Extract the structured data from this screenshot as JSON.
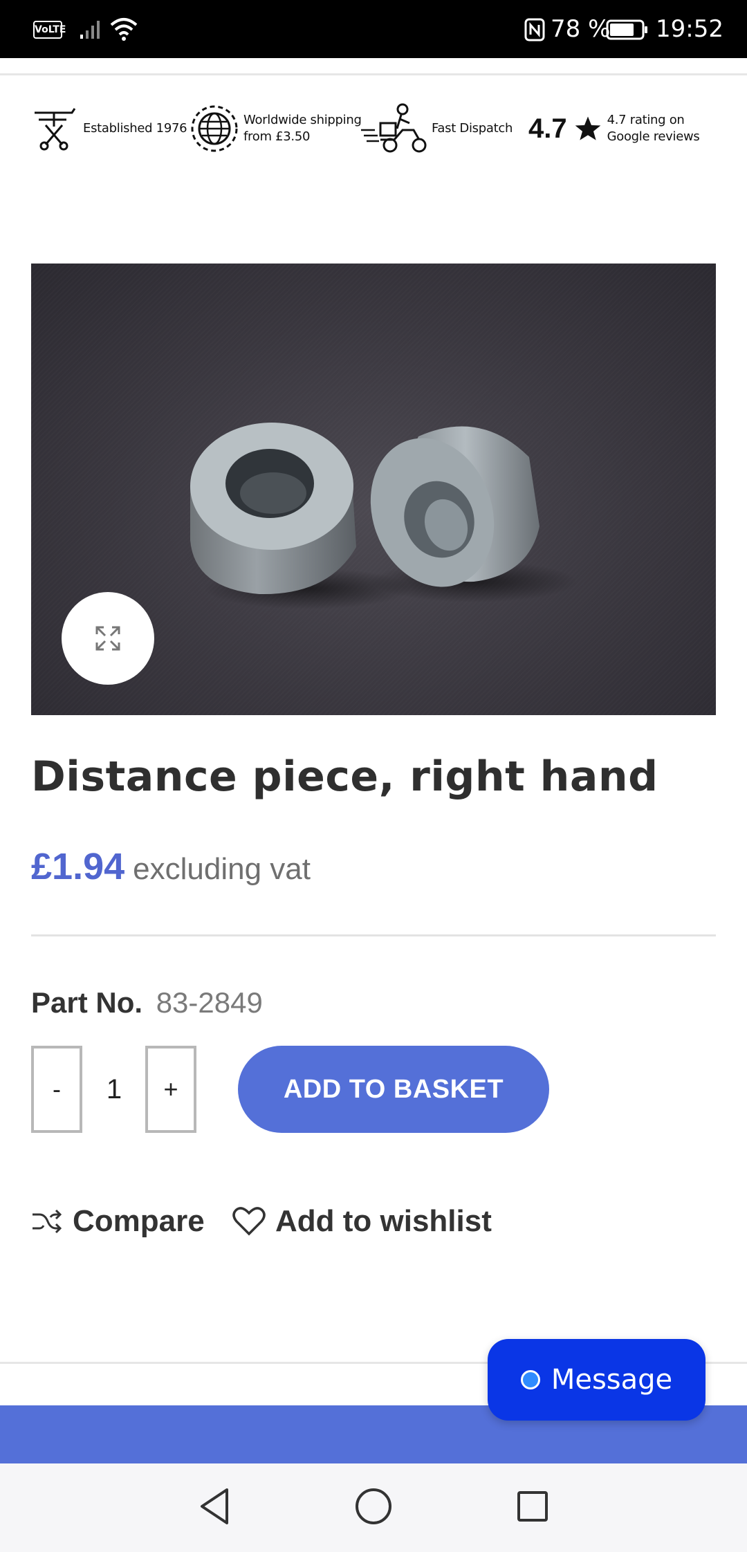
{
  "status_bar": {
    "volte": "VoLTE",
    "battery_percent": "78 %",
    "battery_level": 0.78,
    "time": "19:52"
  },
  "trust": {
    "established": "Established 1976",
    "shipping_line1": "Worldwide shipping",
    "shipping_line2": "from £3.50",
    "dispatch": "Fast Dispatch",
    "rating": "4.7",
    "rating_line1": "4.7 rating on",
    "rating_line2": "Google reviews"
  },
  "product": {
    "title": "Distance piece, right hand",
    "price": "£1.94",
    "price_note": "excluding vat",
    "part_label": "Part No.",
    "part_number": "83-2849"
  },
  "quantity": {
    "minus": "-",
    "value": "1",
    "plus": "+"
  },
  "actions": {
    "add_to_basket": "ADD TO BASKET",
    "compare": "Compare",
    "wishlist": "Add to wishlist"
  },
  "chat": {
    "label": "Message"
  },
  "colors": {
    "accent": "#5470d8",
    "price": "#5166cf",
    "chat": "#0a36e6"
  },
  "icons": [
    "shuffle-icon",
    "heart-icon",
    "expand-icon",
    "star-icon",
    "globe-icon",
    "scooter-icon",
    "sewing-icon"
  ]
}
